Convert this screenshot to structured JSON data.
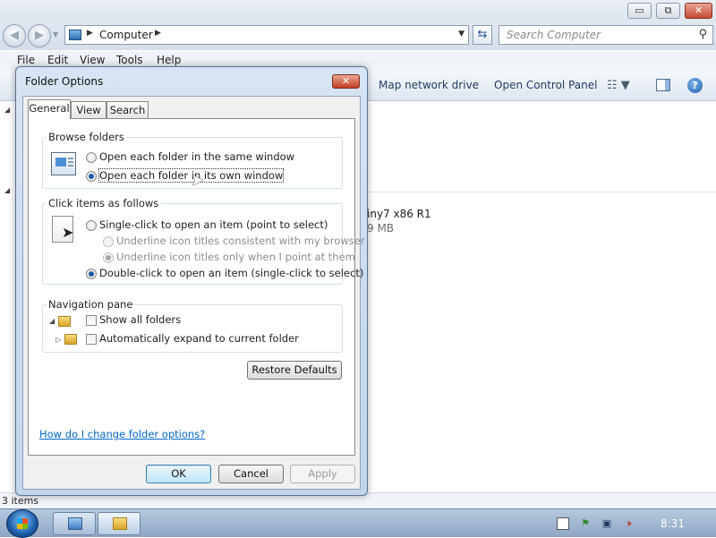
{
  "explorer": {
    "caption_buttons": {
      "minimize": "▭",
      "maximize": "⧉",
      "close": "✕"
    },
    "address": {
      "segment": "Computer"
    },
    "search": {
      "placeholder": "Search Computer"
    },
    "menu": [
      "File",
      "Edit",
      "View",
      "Tools",
      "Help"
    ],
    "toolbar": {
      "map_drive": "Map network drive",
      "control_panel": "Open Control Panel"
    },
    "drive": {
      "name_fragment": "iny7 x86 R1",
      "size_fragment": "9 MB"
    },
    "status": {
      "items": "3 items"
    }
  },
  "dialog": {
    "title": "Folder Options",
    "close_glyph": "✕",
    "tabs": [
      "General",
      "View",
      "Search"
    ],
    "active_tab": "General",
    "browse_folders": {
      "title": "Browse folders",
      "options": [
        "Open each folder in the same window",
        "Open each folder in its own window"
      ],
      "selected": "Open each folder in its own window"
    },
    "click_items": {
      "title": "Click items as follows",
      "single_click": "Single-click to open an item (point to select)",
      "underline_browser": "Underline icon titles consistent with my browser",
      "underline_point": "Underline icon titles only when I point at them",
      "double_click": "Double-click to open an item (single-click to select)",
      "selected": "Double-click to open an item (single-click to select)"
    },
    "navigation_pane": {
      "title": "Navigation pane",
      "show_all_folders": "Show all folders",
      "auto_expand": "Automatically expand to current folder",
      "show_all_checked": false,
      "auto_expand_checked": false
    },
    "restore_defaults": "Restore Defaults",
    "help_link": "How do I change folder options?",
    "buttons": {
      "ok": "OK",
      "cancel": "Cancel",
      "apply": "Apply"
    }
  },
  "taskbar": {
    "clock": "8:31"
  },
  "colors": {
    "link": "#0066cc",
    "accent": "#1f5ca8",
    "taskbar": "#a9bdd7"
  }
}
